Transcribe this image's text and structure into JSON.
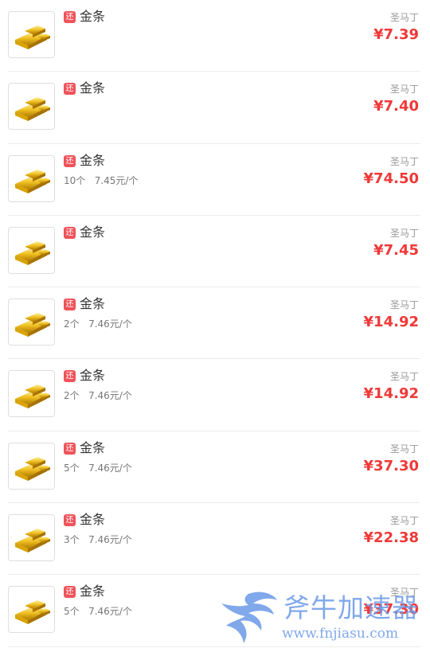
{
  "items": [
    {
      "badge": "还",
      "name": "金条",
      "qty": "",
      "seller": "圣马丁",
      "price": "¥7.39"
    },
    {
      "badge": "还",
      "name": "金条",
      "qty": "",
      "seller": "圣马丁",
      "price": "¥7.40"
    },
    {
      "badge": "还",
      "name": "金条",
      "qty": "10个   7.45元/个",
      "seller": "圣马丁",
      "price": "¥74.50"
    },
    {
      "badge": "还",
      "name": "金条",
      "qty": "",
      "seller": "圣马丁",
      "price": "¥7.45"
    },
    {
      "badge": "还",
      "name": "金条",
      "qty": "2个   7.46元/个",
      "seller": "圣马丁",
      "price": "¥14.92"
    },
    {
      "badge": "还",
      "name": "金条",
      "qty": "2个   7.46元/个",
      "seller": "圣马丁",
      "price": "¥14.92"
    },
    {
      "badge": "还",
      "name": "金条",
      "qty": "5个   7.46元/个",
      "seller": "圣马丁",
      "price": "¥37.30"
    },
    {
      "badge": "还",
      "name": "金条",
      "qty": "3个   7.46元/个",
      "seller": "圣马丁",
      "price": "¥22.38"
    },
    {
      "badge": "还",
      "name": "金条",
      "qty": "5个   7.46元/个",
      "seller": "圣马丁",
      "price": "¥37.30"
    }
  ],
  "thumbnail_icon": "gold-bar-icon",
  "colors": {
    "price": "#f03838",
    "badge": "#f0535a",
    "watermark": "#6a9ae8"
  },
  "watermark": {
    "title": "斧牛加速器",
    "url": "www.fnjiasu.com"
  }
}
